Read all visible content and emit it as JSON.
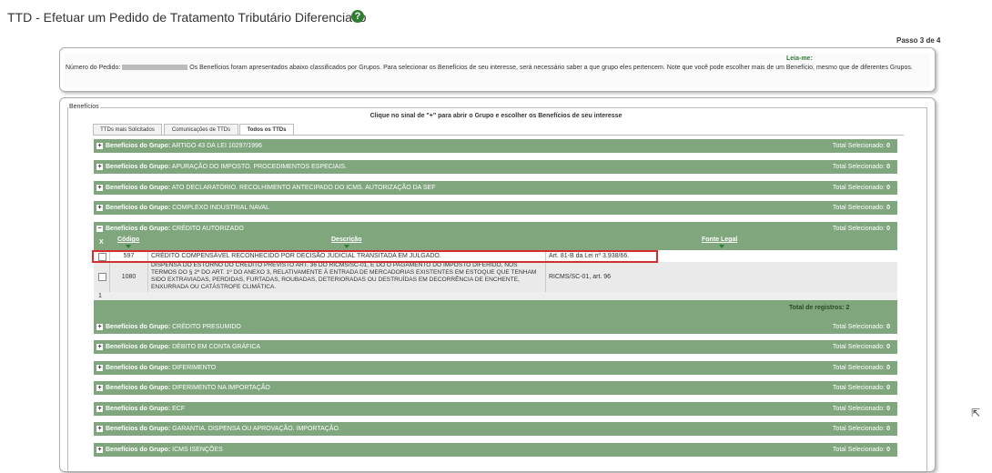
{
  "page": {
    "title": "TTD - Efetuar um Pedido de Tratamento Tributário Diferenciado",
    "help_icon": "?",
    "step": "Passo 3 de 4"
  },
  "info": {
    "leia_me": "Leia-me:",
    "pedido_label": "Número do Pedido:",
    "text": "Os Benefícios foram apresentados abaixo classificados por Grupos. Para selecionar os Benefícios de seu interesse, será necessário saber a que grupo eles pertencem. Note que você pode escolher mais de um Benefício, mesmo que de diferentes Grupos."
  },
  "beneficios": {
    "legend": "Benefícios",
    "instruction": "Clique no sinal de \"+\" para abrir o Grupo e escolher os Benefícios de seu interesse",
    "tabs": [
      "TTDs mais Solicitados",
      "Comunicações de TTDs",
      "Todos os TTDs"
    ],
    "active_tab": 2,
    "group_prefix": "Benefícios do Grupo:",
    "total_label": "Total Selecionado:",
    "groups_before": [
      {
        "name": "ARTIGO 43 DA LEI 10297/1996",
        "total": "0"
      },
      {
        "name": "APURAÇÃO DO IMPOSTO. PROCEDIMENTOS ESPECIAIS.",
        "total": "0"
      },
      {
        "name": "ATO DECLARATÓRIO. RECOLHIMENTO ANTECIPADO DO ICMS. AUTORIZAÇÃO DA SEF",
        "total": "0"
      },
      {
        "name": "COMPLEXO INDUSTRIAL NAVAL",
        "total": "0"
      }
    ],
    "expanded_group": {
      "name": "CRÉDITO AUTORIZADO",
      "total": "0",
      "col_x": "X",
      "col_codigo": "Código",
      "col_descricao": "Descrição",
      "col_fonte": "Fonte Legal",
      "rows": [
        {
          "codigo": "597",
          "descricao": "CRÉDITO COMPENSÁVEL RECONHECIDO POR DECISÃO JUDICIAL TRANSITADA EM JULGADO.",
          "fonte": "Art. 81-B da Lei nº 3.938/66."
        },
        {
          "codigo": "1080",
          "descricao": "DISPENSA DO ESTORNO DO CRÉDITO PREVISTO ART. 36 DO RICMS/SC-01, E DO O PAGAMENTO DO IMPOSTO DIFERIDO, NOS TERMOS DO § 2º DO ART. 1º DO ANEXO 3, RELATIVAMENTE À ENTRADA DE MERCADORIAS EXISTENTES EM ESTOQUE QUE TENHAM SIDO EXTRAVIADAS, PERDIDAS, FURTADAS, ROUBADAS, DETERIORADAS OU DESTRUÍDAS EM DECORRÊNCIA DE ENCHENTE, ENXURRADA OU CATÁSTROFE CLIMÁTICA.",
          "fonte": "RICMS/SC-01, art. 96"
        }
      ],
      "pager": "1",
      "total_registros": "Total de registros: 2"
    },
    "groups_after": [
      {
        "name": "CRÉDITO PRESUMIDO",
        "total": "0"
      },
      {
        "name": "DÉBITO EM CONTA GRÁFICA",
        "total": "0"
      },
      {
        "name": "DIFERIMENTO",
        "total": "0"
      },
      {
        "name": "DIFERIMENTO NA IMPORTAÇÃO",
        "total": "0"
      },
      {
        "name": "ECF",
        "total": "0"
      },
      {
        "name": "GARANTIA. DISPENSA OU APROVAÇÃO. IMPORTAÇÃO.",
        "total": "0"
      },
      {
        "name": "ICMS ISENÇÕES",
        "total": "0"
      }
    ]
  }
}
